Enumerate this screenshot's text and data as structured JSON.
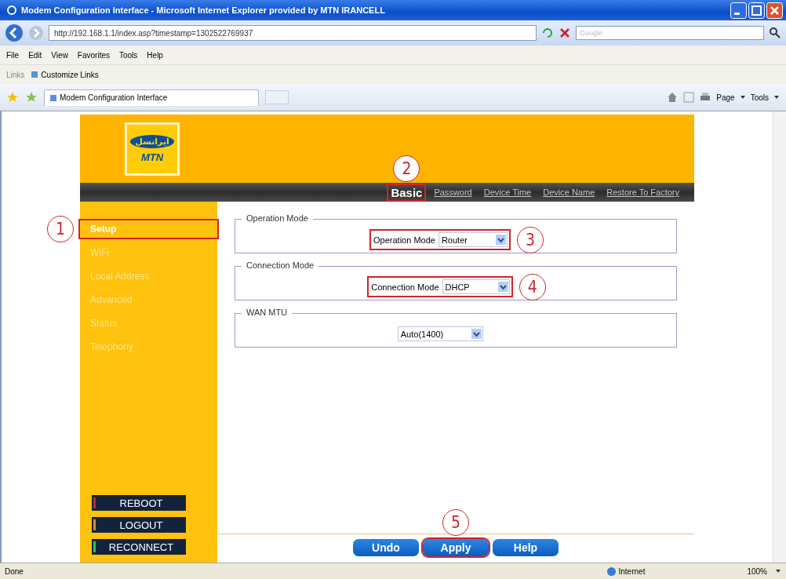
{
  "window": {
    "title": "Modem Configuration Interface - Microsoft Internet Explorer provided by MTN IRANCELL"
  },
  "address_bar": {
    "url": "http://192.168.1.1/index.asp?timestamp=1302522769937"
  },
  "search": {
    "placeholder": "Google"
  },
  "menu": [
    "File",
    "Edit",
    "View",
    "Favorites",
    "Tools",
    "Help"
  ],
  "links_bar": {
    "label": "Links",
    "items": [
      "Customize Links"
    ]
  },
  "tabs": [
    {
      "label": "Modem Configuration Interface",
      "selected": true
    }
  ],
  "command_bar": [
    "Page",
    "Tools"
  ],
  "page": {
    "logo": {
      "text_top": "ایرانسل",
      "text_bottom": "MTN"
    },
    "nav": [
      {
        "label": "Basic",
        "selected": true,
        "highlighted": true,
        "callout": "2"
      },
      {
        "label": "Password",
        "selected": false,
        "highlighted": false
      },
      {
        "label": "Device Time",
        "selected": false,
        "highlighted": false
      },
      {
        "label": "Device Name",
        "selected": false,
        "highlighted": false
      },
      {
        "label": "Restore To Factory",
        "selected": false,
        "highlighted": false
      }
    ],
    "sidebar": [
      {
        "label": "Setup",
        "selected": true,
        "highlighted": true,
        "callout": "1"
      },
      {
        "label": "WiFi",
        "selected": false,
        "highlighted": false
      },
      {
        "label": "Local Address",
        "selected": false,
        "highlighted": false
      },
      {
        "label": "Advanced",
        "selected": false,
        "highlighted": false
      },
      {
        "label": "Status",
        "selected": false,
        "highlighted": false
      },
      {
        "label": "Telephony",
        "selected": false,
        "highlighted": false
      }
    ],
    "side_buttons": [
      {
        "label": "REBOOT",
        "color": "#c0282d"
      },
      {
        "label": "LOGOUT",
        "color": "#e0892a"
      },
      {
        "label": "RECONNECT",
        "color": "#2fc24a"
      }
    ],
    "sections": [
      {
        "legend": "Operation Mode",
        "label": "Operation Mode",
        "value": "Router",
        "highlighted": true,
        "callout": "3"
      },
      {
        "legend": "Connection Mode",
        "label": "Connection Mode",
        "value": "DHCP",
        "highlighted": true,
        "callout": "4"
      },
      {
        "legend": "WAN MTU",
        "value": "Auto(1400)",
        "highlighted": false
      }
    ],
    "buttons": [
      {
        "label": "Undo",
        "highlighted": false
      },
      {
        "label": "Apply",
        "highlighted": true,
        "callout": "5"
      },
      {
        "label": "Help",
        "highlighted": false
      }
    ]
  },
  "status_bar": {
    "text": "Done",
    "zone": "Internet",
    "zoom": "100%"
  }
}
